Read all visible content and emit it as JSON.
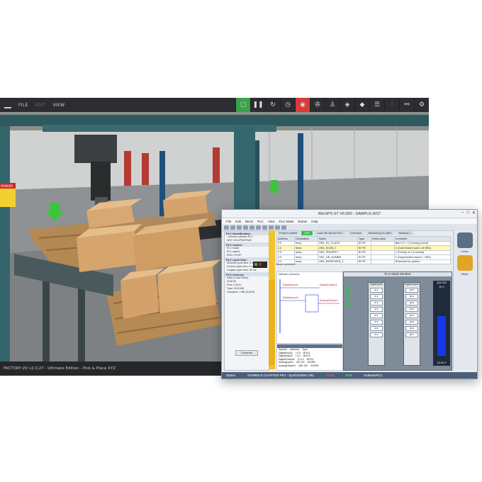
{
  "factoryio": {
    "menu": [
      "FILE",
      "EDIT",
      "VIEW"
    ],
    "tools": [
      "select-icon",
      "pause-icon",
      "reset-icon",
      "timer-icon",
      "camera-icon",
      "fan-icon",
      "person-icon",
      "drop-icon",
      "diamond-icon",
      "list-icon",
      "signal-icon",
      "tags-icon",
      "gear-icon"
    ],
    "status": "FACTORY I/O v2.0.27 - Ultimate Edition - Pick & Place XYZ",
    "sign_text": "DANGER"
  },
  "winsps": {
    "title": "WinSPS-S7 V6.000 - SAMPLE.WS7",
    "menu": [
      "File",
      "Edit",
      "Block",
      "PLC",
      "View",
      "PLC-Mask",
      "Extras",
      "Help"
    ],
    "left": {
      "identification_header": "PLC Identification:",
      "identification_lines": [
        "- Internal software PLC -",
        "WS7 315-2PN/DP/AB"
      ],
      "modes_header": "PLC modes:",
      "modes_lines": [
        "PLC mode:",
        "PLC switch:"
      ],
      "run_label": "RUN",
      "stop_label": "STOP",
      "cycle_header": "PLC cycle time:",
      "cycle_lines": [
        "Shortest cycle time:  0 ms",
        "Current cycle time:   2 ms",
        "Longest cycle time:  39 ms"
      ],
      "memory_header": "PLC memory",
      "memory_lines": [
        "RAM (Code+Data):",
        "  0128 Mi",
        "  Free: 0,00 B",
        "Total:  0128 MB",
        "Occupied:  1 MB (0,63%)"
      ],
      "button": "Compress"
    },
    "tabs": [
      "Project content",
      "OB1",
      "Load OB into the PLC",
      "Overview",
      "Monitoring On (MF)",
      "Network 1"
    ],
    "symbol_table": {
      "headers": [
        "Address",
        "Declaration",
        "Name",
        "Type",
        "Initial value",
        "Comment"
      ],
      "rows": [
        [
          "0.0",
          "temp",
          "OB1_EV_CLASS",
          "BYTE",
          "",
          "Bits 0-3 = 1 (Coming event)"
        ],
        [
          "1.0",
          "temp",
          "OB1_SCAN_1",
          "BYTE",
          "",
          "1 (Cold restart scan 1 of OB1)"
        ],
        [
          "2.0",
          "temp",
          "OB1_PRIORITY",
          "BYTE",
          "",
          "1 (Priority of 1 is lowest)"
        ],
        [
          "3.0",
          "temp",
          "OB1_OB_NUMBR",
          "BYTE",
          "",
          "1 (Organization block 1, OB1)"
        ],
        [
          "4.0",
          "temp",
          "OB1_RESERVED_1",
          "BYTE",
          "",
          "Reserved for system"
        ]
      ]
    },
    "block_comment": "Block comment:",
    "network_comment": "Network comment:",
    "ladder_labels": [
      "DigitalInput1",
      "DigitalInput2",
      "DigitalOutput1",
      "AnalogOutput1"
    ],
    "symtab": {
      "headers": [
        "Symbol",
        "Address",
        "Type"
      ],
      "rows": [
        [
          "DigitalInput1",
          "I 0.0",
          "BOOL"
        ],
        [
          "DigitalInput2",
          "I 0.1",
          "BOOL"
        ],
        [
          "DigitalOutput1",
          "Q 0.0",
          "BOOL"
        ],
        [
          "AnalogInput1",
          "IW 100",
          "WORD"
        ],
        [
          "AnalogOutput1",
          "QW 100",
          "WORD"
        ]
      ]
    },
    "mask": {
      "title": "PLC-Mask Window",
      "col1": "DigitalInput0",
      "col2": "DigitalOutput0",
      "cells1": [
        "I0.0",
        "I0.1",
        "I0.2",
        "I0.3",
        "I0.4",
        "I0.5",
        "I0.6",
        "I0.7"
      ],
      "cells2": [
        "Q0.0",
        "Q0.1",
        "Q0.2",
        "Q0.3",
        "Q0.4",
        "Q0.5",
        "Q0.6",
        "Q0.7"
      ],
      "gauge_label": "QW 100",
      "gauge_top": "10 V",
      "gauge_value": "10.00 V",
      "gauge_level": 0.62
    },
    "right": {
      "label1": "Online",
      "label2": "Offline"
    },
    "status": [
      "Status:",
      "SYMBOLE CHAPTER.PRJ - SymbolTable OB1",
      "STOP",
      "RUN",
      "SoftwarePLC"
    ]
  }
}
